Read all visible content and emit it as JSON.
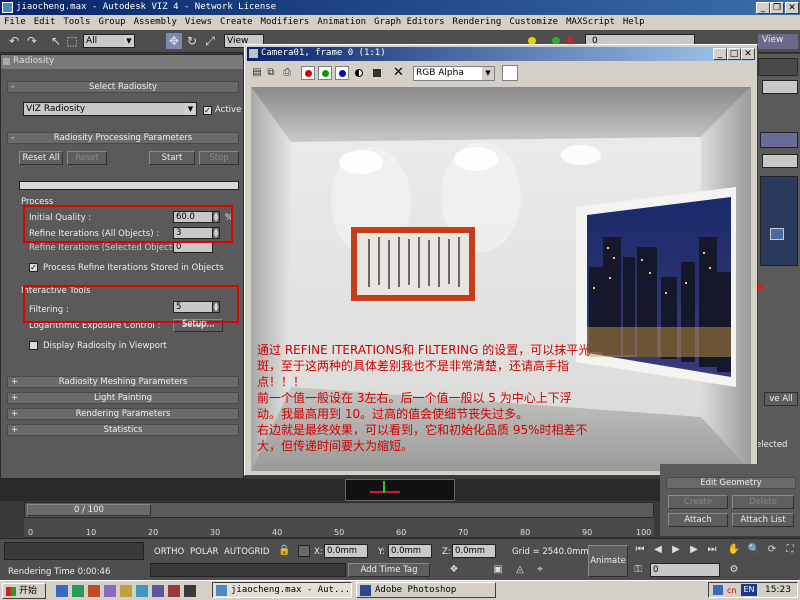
{
  "app": {
    "title": "jiaocheng.max - Autodesk VIZ 4 - Network License",
    "window_buttons": [
      "_",
      "❐",
      "✕"
    ]
  },
  "menu": [
    "File",
    "Edit",
    "Tools",
    "Group",
    "Assembly",
    "Views",
    "Create",
    "Modifiers",
    "Animation",
    "Graph Editors",
    "Rendering",
    "Customize",
    "MAXScript",
    "Help"
  ],
  "toolbar": {
    "selection_filter": "All",
    "view_dropdown": "View",
    "right_dropdown_value": "0",
    "right_view_label": "View"
  },
  "radiosity_panel": {
    "title": "Radiosity",
    "select_rollout": "Select Radiosity",
    "engine": "VIZ Radiosity",
    "active_label": "Active",
    "processing_rollout": "Radiosity Processing Parameters",
    "buttons": {
      "reset_all": "Reset All",
      "reset": "Reset",
      "start": "Start",
      "stop": "Stop"
    },
    "process_group": "Process",
    "initial_quality_label": "Initial Quality :",
    "initial_quality_value": "60.0",
    "initial_quality_unit": "%",
    "refine_all_label": "Refine Iterations (All Objects) :",
    "refine_all_value": "3",
    "refine_selected_label": "Refine Iterations (Selected Objects) :",
    "refine_selected_value": "0",
    "process_refine_label": "Process Refine Iterations Stored in Objects",
    "interactive_group": "Interactive Tools",
    "filtering_label": "Filtering :",
    "filtering_value": "5",
    "exposure_label": "Logarithmic Exposure Control :",
    "setup_button": "Setup...",
    "display_label": "Display Radiosity in Viewport",
    "rollouts": [
      "Radiosity Meshing Parameters",
      "Light Painting",
      "Rendering Parameters",
      "Statistics"
    ]
  },
  "render_window": {
    "title": "Camera01, frame 0 (1:1)",
    "channel": "RGB Alpha",
    "annotation": [
      "通过 REFINE ITERATIONS和 FILTERING 的设置，可以抹平光",
      "斑，至于这两种的具体差别我也不是非常清楚，还请高手指",
      "点！！！",
      "前一个值一般设在 3左右。后一个值一般以 5 为中心上下浮",
      "动。我最高用到 10。过高的值会使细节丧失过多。",
      "右边就是最终效果，可以看到，它和初始化品质 95%时相差不",
      "大，但传递时间要大为缩短。"
    ]
  },
  "right_panel": {
    "edit_geometry": "Edit Geometry",
    "create": "Create",
    "delete": "Delete",
    "attach": "Attach",
    "attach_list": "Attach List",
    "ve_all": "ve All",
    "elected": "elected"
  },
  "timeline": {
    "frame_display": "0 / 100",
    "ticks": [
      "0",
      "10",
      "20",
      "30",
      "40",
      "50",
      "60",
      "70",
      "80",
      "90",
      "100"
    ]
  },
  "statusbar": {
    "ortho": "ORTHO",
    "polar": "POLAR",
    "autogrid": "AUTOGRID",
    "x_label": "X:",
    "x_value": "0.0mm",
    "y_label": "Y:",
    "y_value": "0.0mm",
    "z_label": "Z:",
    "z_value": "0.0mm",
    "grid": "Grid = 2540.0mm",
    "animate": "Animate",
    "rendering_time": "Rendering Time  0:00:46",
    "add_time_tag": "Add Time Tag",
    "frame_value": "0"
  },
  "taskbar": {
    "start": "开始",
    "tasks": [
      "jiaocheng.max - Aut...",
      "Adobe Photoshop"
    ],
    "tray": [
      "EN",
      "cn"
    ],
    "clock": "15:23"
  },
  "colors": {
    "title_bar": "#0a246a",
    "chrome": "#d4d0c8",
    "panel": "#5a5a5a",
    "highlight_box": "#e00000",
    "annotation_text": "#d00000",
    "frame_border": "#c83c1e"
  }
}
